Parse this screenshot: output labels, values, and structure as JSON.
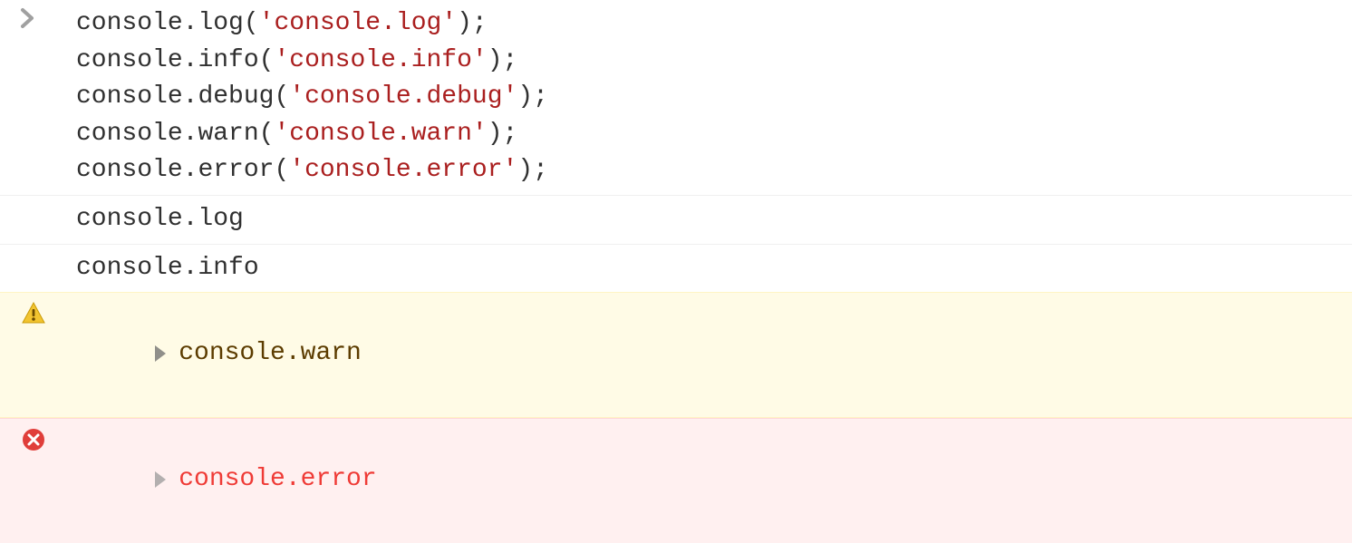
{
  "input": {
    "lines": [
      {
        "obj": "console",
        "method": "log",
        "arg": "'console.log'"
      },
      {
        "obj": "console",
        "method": "info",
        "arg": "'console.info'"
      },
      {
        "obj": "console",
        "method": "debug",
        "arg": "'console.debug'"
      },
      {
        "obj": "console",
        "method": "warn",
        "arg": "'console.warn'"
      },
      {
        "obj": "console",
        "method": "error",
        "arg": "'console.error'"
      }
    ]
  },
  "output": {
    "log": "console.log",
    "info": "console.info",
    "warn": "console.warn",
    "error": "console.error"
  }
}
